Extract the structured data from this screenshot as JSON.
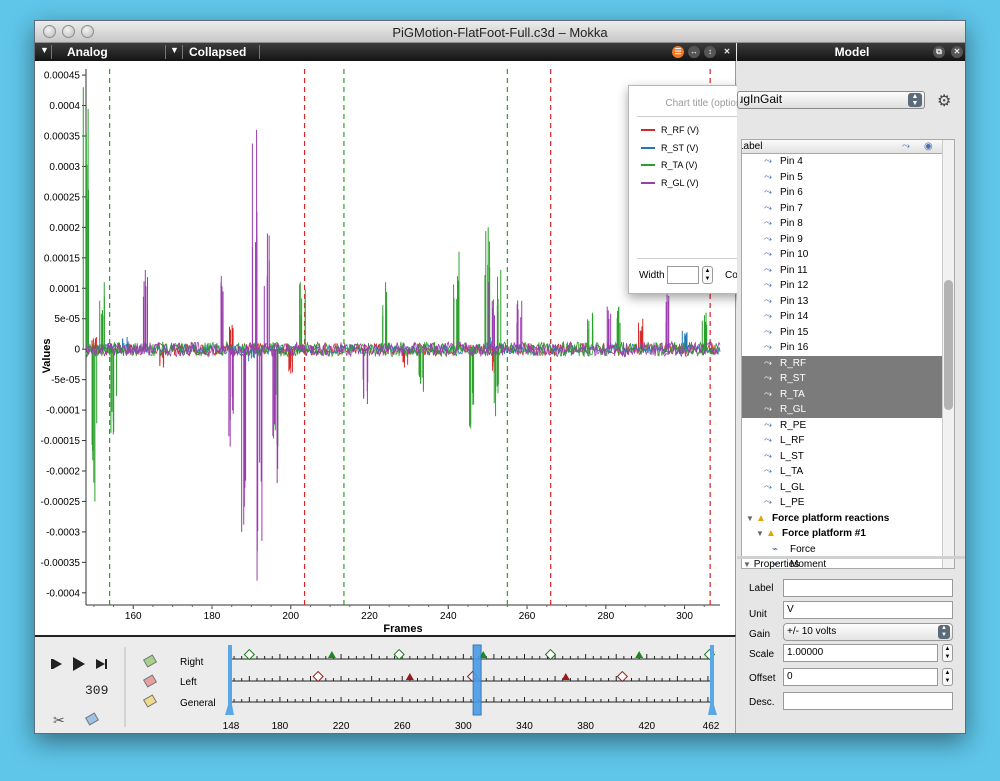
{
  "window": {
    "title": "PiGMotion-FlatFoot-Full.c3d – Mokka"
  },
  "left_panel": {
    "view_label": "Analog",
    "mode_label": "Collapsed"
  },
  "right_panel": {
    "title": "Model"
  },
  "model_select": {
    "value": "PlugInGait"
  },
  "tree_header": {
    "label": "Label"
  },
  "tree_items": [
    {
      "label": "Pin 4",
      "selected": false
    },
    {
      "label": "Pin 5",
      "selected": false
    },
    {
      "label": "Pin 6",
      "selected": false
    },
    {
      "label": "Pin 7",
      "selected": false
    },
    {
      "label": "Pin 8",
      "selected": false
    },
    {
      "label": "Pin 9",
      "selected": false
    },
    {
      "label": "Pin 10",
      "selected": false
    },
    {
      "label": "Pin 11",
      "selected": false
    },
    {
      "label": "Pin 12",
      "selected": false
    },
    {
      "label": "Pin 13",
      "selected": false
    },
    {
      "label": "Pin 14",
      "selected": false
    },
    {
      "label": "Pin 15",
      "selected": false
    },
    {
      "label": "Pin 16",
      "selected": false
    },
    {
      "label": "R_RF",
      "selected": true
    },
    {
      "label": "R_ST",
      "selected": true
    },
    {
      "label": "R_TA",
      "selected": true
    },
    {
      "label": "R_GL",
      "selected": true
    },
    {
      "label": "R_PE",
      "selected": false
    },
    {
      "label": "L_RF",
      "selected": false
    },
    {
      "label": "L_ST",
      "selected": false
    },
    {
      "label": "L_TA",
      "selected": false
    },
    {
      "label": "L_GL",
      "selected": false
    },
    {
      "label": "L_PE",
      "selected": false
    }
  ],
  "tree_groups": {
    "force_reactions": "Force platform reactions",
    "platform": "Force platform #1",
    "force": "Force",
    "moment": "Moment"
  },
  "properties": {
    "title": "Properties",
    "label_caption": "Label",
    "label_value": "",
    "unit_caption": "Unit",
    "unit_value": "V",
    "gain_caption": "Gain",
    "gain_value": "+/- 10 volts",
    "scale_caption": "Scale",
    "scale_value": "1.00000",
    "offset_caption": "Offset",
    "offset_value": "0",
    "desc_caption": "Desc.",
    "desc_value": ""
  },
  "chart_popup": {
    "title_placeholder": "Chart title (optional)",
    "width_label": "Width",
    "color_label": "Color",
    "legend": [
      {
        "name": "R_RF (V)",
        "color": "#d62728"
      },
      {
        "name": "R_ST (V)",
        "color": "#1f77b4"
      },
      {
        "name": "R_TA (V)",
        "color": "#2ca02c"
      },
      {
        "name": "R_GL (V)",
        "color": "#9b3dae"
      }
    ]
  },
  "timeline": {
    "current_frame": "309",
    "tracks": [
      "Right",
      "Left",
      "General"
    ],
    "ticks": [
      "148",
      "180",
      "220",
      "260",
      "300",
      "340",
      "380",
      "420",
      "462"
    ]
  },
  "chart_data": {
    "type": "line",
    "title": "",
    "xlabel": "Frames",
    "ylabel": "Values",
    "xlim": [
      148,
      309
    ],
    "ylim": [
      -0.00042,
      0.00046
    ],
    "x_ticks": [
      "160",
      "180",
      "200",
      "220",
      "240",
      "260",
      "280",
      "300"
    ],
    "y_ticks": [
      "0.00045",
      "0.0004",
      "0.00035",
      "0.0003",
      "0.00025",
      "0.0002",
      "0.00015",
      "0.0001",
      "5e-05",
      "0",
      "-5e-05",
      "-0.0001",
      "-0.00015",
      "-0.0002",
      "-0.00025",
      "-0.0003",
      "-0.00035",
      "-0.0004"
    ],
    "event_lines": [
      {
        "frame": 154,
        "color": "#2ca02c"
      },
      {
        "frame": 203.5,
        "color": "#d62728"
      },
      {
        "frame": 213.5,
        "color": "#2ca02c"
      },
      {
        "frame": 255,
        "color": "#2ca02c"
      },
      {
        "frame": 266,
        "color": "#d62728"
      },
      {
        "frame": 306.5,
        "color": "#d62728"
      }
    ],
    "series": [
      {
        "name": "R_RF (V)",
        "color": "#d62728",
        "peaks": [
          [
            150,
            2e-05
          ],
          [
            167,
            -3e-05
          ],
          [
            185,
            4e-05
          ],
          [
            200,
            -4e-05
          ],
          [
            229,
            -3e-05
          ],
          [
            252,
            -4e-05
          ],
          [
            289,
            5e-05
          ]
        ]
      },
      {
        "name": "R_ST (V)",
        "color": "#1f77b4",
        "peaks": [
          [
            158,
            2e-05
          ],
          [
            190,
            -2e-05
          ],
          [
            250,
            2e-05
          ],
          [
            300,
            3e-05
          ]
        ]
      },
      {
        "name": "R_TA (V)",
        "color": "#2ca02c",
        "peaks": [
          [
            148,
            0.00043
          ],
          [
            150,
            -0.00025
          ],
          [
            152,
            0.00011
          ],
          [
            155,
            -0.00014
          ],
          [
            196,
            -0.00016
          ],
          [
            203,
            0.00011
          ],
          [
            224,
            0.00011
          ],
          [
            233,
            -7e-05
          ],
          [
            242,
            0.00016
          ],
          [
            246,
            -0.00013
          ],
          [
            250,
            0.0002
          ],
          [
            252,
            -0.00011
          ],
          [
            253,
            0.00013
          ],
          [
            276,
            6e-05
          ],
          [
            283,
            7e-05
          ],
          [
            305,
            6e-05
          ]
        ]
      },
      {
        "name": "R_GL (V)",
        "color": "#9b3dae",
        "peaks": [
          [
            163,
            0.00013
          ],
          [
            183,
            0.00012
          ],
          [
            185,
            -0.00016
          ],
          [
            191,
            0.00036
          ],
          [
            192,
            -0.00038
          ],
          [
            188,
            -0.0003
          ],
          [
            194,
            0.00019
          ],
          [
            196,
            -0.00022
          ],
          [
            219,
            -9e-05
          ],
          [
            251,
            0.00011
          ],
          [
            258,
            8e-05
          ],
          [
            281,
            7e-05
          ],
          [
            296,
            9e-05
          ]
        ]
      }
    ]
  }
}
